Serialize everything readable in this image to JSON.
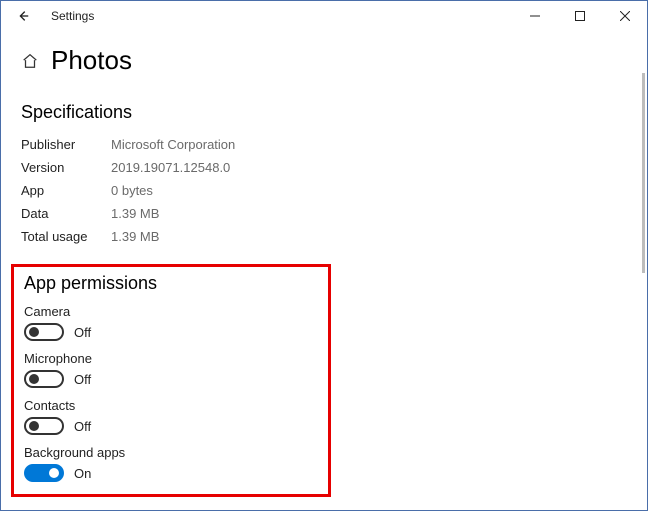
{
  "window": {
    "title": "Settings"
  },
  "header": {
    "page_title": "Photos"
  },
  "specifications": {
    "title": "Specifications",
    "rows": [
      {
        "label": "Publisher",
        "value": "Microsoft Corporation"
      },
      {
        "label": "Version",
        "value": "2019.19071.12548.0"
      },
      {
        "label": "App",
        "value": "0 bytes"
      },
      {
        "label": "Data",
        "value": "1.39 MB"
      },
      {
        "label": "Total usage",
        "value": "1.39 MB"
      }
    ]
  },
  "permissions": {
    "title": "App permissions",
    "items": [
      {
        "label": "Camera",
        "state_text": "Off",
        "on": false
      },
      {
        "label": "Microphone",
        "state_text": "Off",
        "on": false
      },
      {
        "label": "Contacts",
        "state_text": "Off",
        "on": false
      },
      {
        "label": "Background apps",
        "state_text": "On",
        "on": true
      }
    ]
  }
}
